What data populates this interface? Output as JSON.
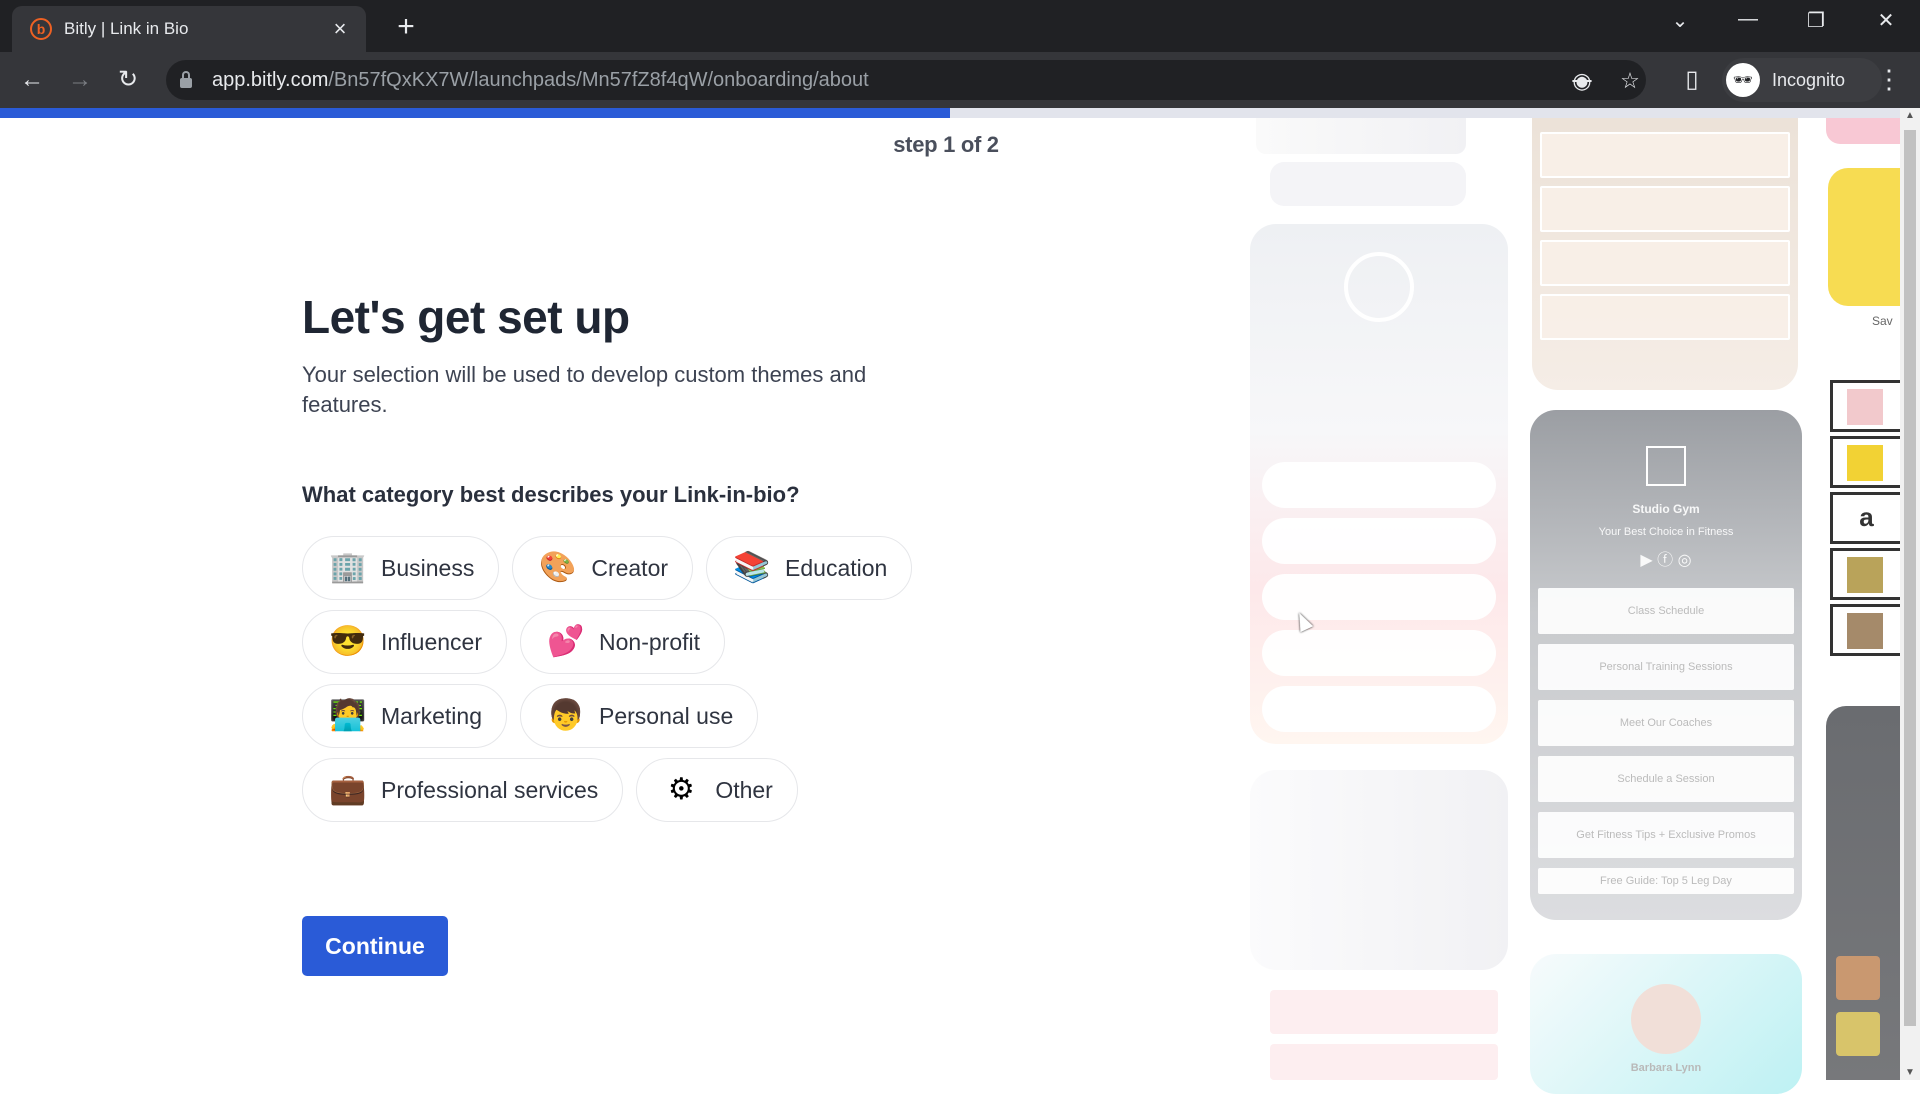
{
  "browser": {
    "tab_title": "Bitly | Link in Bio",
    "tab_favicon": "b",
    "new_tab_icon": "+",
    "url_host": "app.bitly.com",
    "url_path": "/Bn57fQxKX7W/launchpads/Mn57fZ8f4qW/onboarding/about",
    "profile_label": "Incognito",
    "window_controls": {
      "tab_search": "⌄",
      "minimize": "—",
      "restore": "❐",
      "close": "✕"
    },
    "nav": {
      "back": "←",
      "forward": "→",
      "reload": "↻"
    },
    "omni_icons": {
      "eye_off": "◉",
      "star": "☆",
      "sidepanel": "▯",
      "menu": "⋮"
    }
  },
  "onboarding": {
    "progress_percent": 50,
    "step_label": "step 1 of 2",
    "heading": "Let's get set up",
    "subtitle": "Your selection will be used to develop custom themes and features.",
    "question": "What category best describes your Link-in-bio?",
    "categories": [
      {
        "label": "Business",
        "icon": "🏢",
        "icon_name": "office-building-icon"
      },
      {
        "label": "Creator",
        "icon": "🎨",
        "icon_name": "artist-palette-icon"
      },
      {
        "label": "Education",
        "icon": "📚",
        "icon_name": "books-icon"
      },
      {
        "label": "Influencer",
        "icon": "😎",
        "icon_name": "sunglasses-face-icon"
      },
      {
        "label": "Non-profit",
        "icon": "💕",
        "icon_name": "two-hearts-icon"
      },
      {
        "label": "Marketing",
        "icon": "🧑‍💻",
        "icon_name": "technologist-icon"
      },
      {
        "label": "Personal use",
        "icon": "👦",
        "icon_name": "person-face-icon"
      },
      {
        "label": "Professional services",
        "icon": "💼",
        "icon_name": "briefcase-icon"
      },
      {
        "label": "Other",
        "icon": "⚙",
        "icon_name": "gear-icon"
      }
    ],
    "continue_label": "Continue"
  },
  "preview": {
    "gym_title": "Studio Gym",
    "gym_tagline": "Your Best Choice in Fitness",
    "gym_links": [
      "Class Schedule",
      "Personal Training Sessions",
      "Meet Our Coaches",
      "Schedule a Session",
      "Get Fitness Tips + Exclusive Promos",
      "Free Guide: Top 5 Leg Day"
    ],
    "profile_name": "Barbara Lynn",
    "side_label": "Sav",
    "amazon_glyph": "a"
  }
}
